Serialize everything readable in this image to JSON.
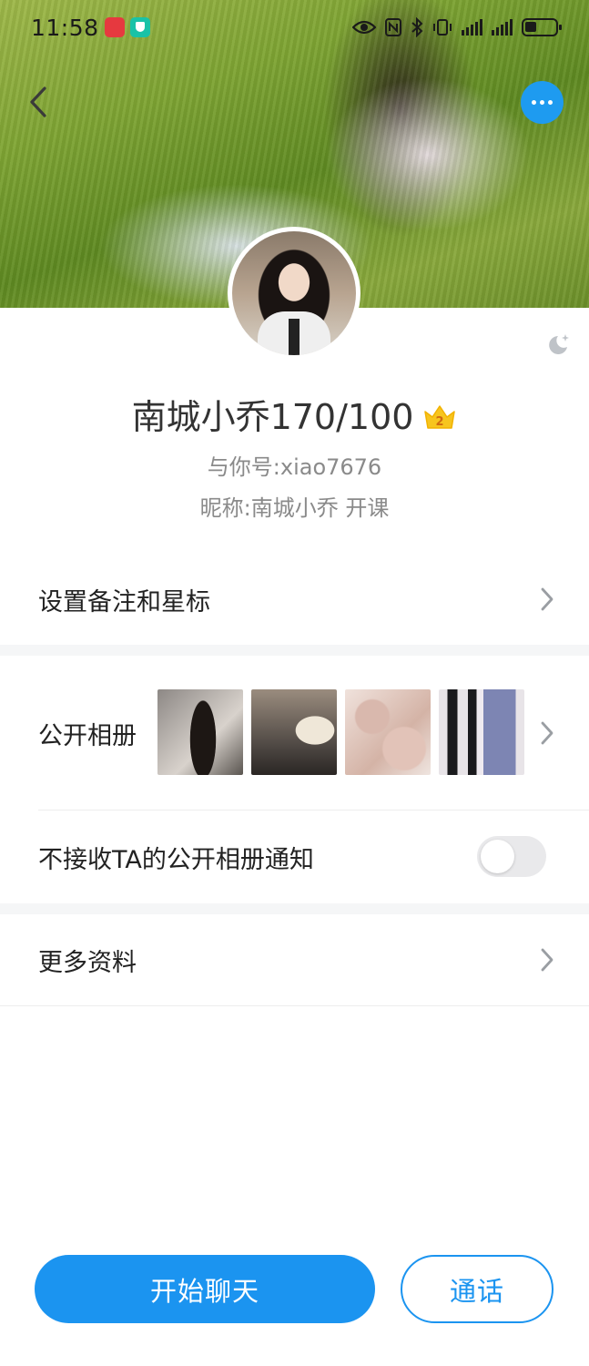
{
  "status_bar": {
    "time": "11:58",
    "battery_level": 0.35
  },
  "header": {
    "back_icon": "chevron-left-icon",
    "more_icon": "more-dots-icon",
    "more_button_color": "#1e9bf0"
  },
  "profile": {
    "name": "南城小乔170/100",
    "vip_level": "2",
    "account_id": "与你号:xiao7676",
    "nickname": "昵称:南城小乔 开课"
  },
  "rows": {
    "remark": "设置备注和星标",
    "album": "公开相册",
    "album_notify": "不接收TA的公开相册通知",
    "album_notify_enabled": false,
    "more_info": "更多资料"
  },
  "actions": {
    "chat": "开始聊天",
    "call": "通话",
    "accent_color": "#1b94f0"
  }
}
